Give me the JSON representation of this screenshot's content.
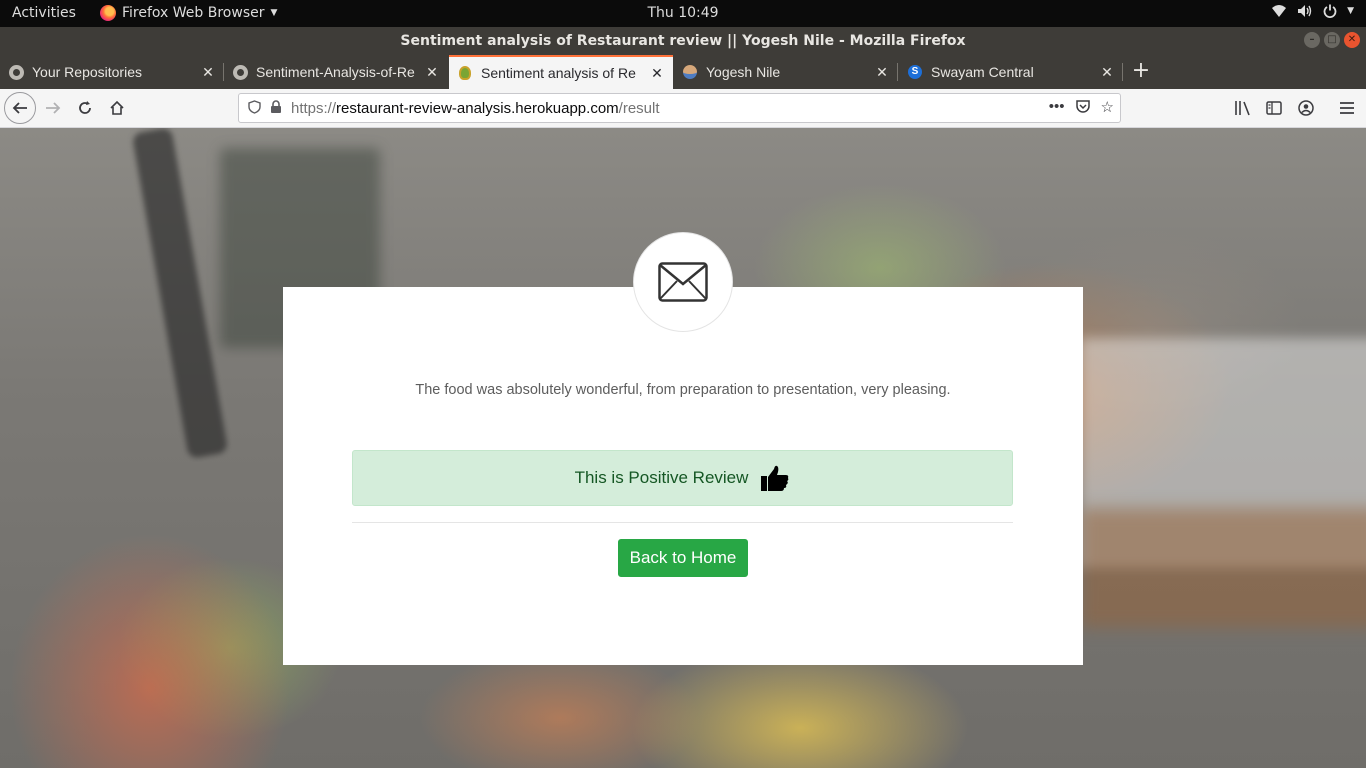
{
  "topbar": {
    "activities": "Activities",
    "app_name": "Firefox Web Browser",
    "clock": "Thu 10:49"
  },
  "window": {
    "title": "Sentiment analysis of Restaurant review || Yogesh Nile - Mozilla Firefox"
  },
  "tabs": [
    {
      "label": "Your Repositories",
      "icon": "github-icon",
      "active": false
    },
    {
      "label": "Sentiment-Analysis-of-Re",
      "icon": "github-icon",
      "active": false
    },
    {
      "label": "Sentiment analysis of Re",
      "icon": "leaf-icon",
      "active": true
    },
    {
      "label": "Yogesh Nile",
      "icon": "avatar-icon",
      "active": false
    },
    {
      "label": "Swayam Central",
      "icon": "swayam-icon",
      "active": false
    }
  ],
  "url": {
    "prefix": "https://",
    "host": "restaurant-review-analysis.herokuapp.com",
    "path": "/result"
  },
  "page": {
    "review_text": "The food was absolutely wonderful, from preparation to presentation, very pleasing.",
    "result_text": "This is Positive Review",
    "back_button": "Back to Home"
  },
  "colors": {
    "alert_bg": "#d4edda",
    "alert_text": "#155724",
    "button_green": "#28a745",
    "active_tab_accent": "#ff7139"
  }
}
